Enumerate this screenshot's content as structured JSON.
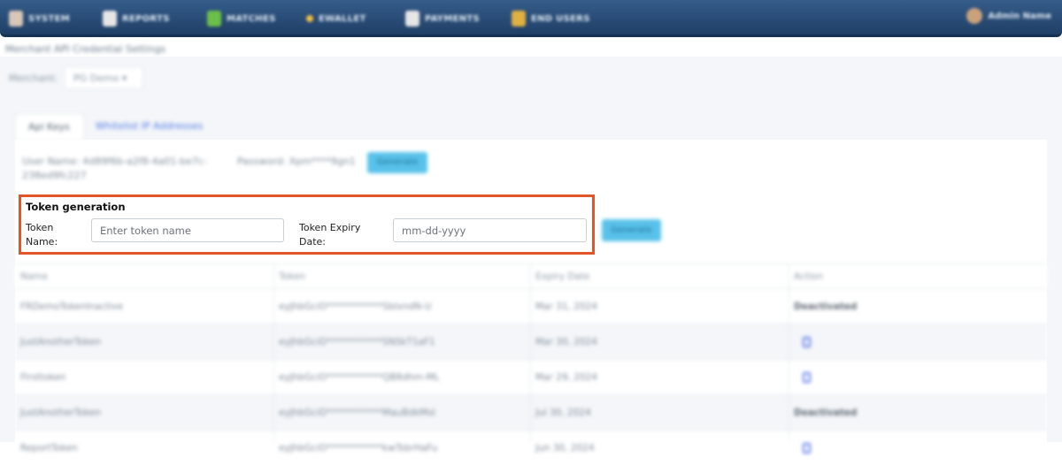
{
  "nav": {
    "items": [
      {
        "label": "SYSTEM",
        "icon": "system-icon",
        "color": "#d9c8b8"
      },
      {
        "label": "REPORTS",
        "icon": "reports-icon",
        "color": "#e6e6e6"
      },
      {
        "label": "MATCHES",
        "icon": "matches-icon",
        "color": "#6cc04a"
      },
      {
        "label": "EWALLET",
        "icon": "ewallet-icon",
        "color": "#f0c040"
      },
      {
        "label": "PAYMENTS",
        "icon": "payments-icon",
        "color": "#e6e6e6"
      },
      {
        "label": "END USERS",
        "icon": "end-users-icon",
        "color": "#e0b040"
      }
    ],
    "user": "Admin Name"
  },
  "breadcrumb": "Merchant API Credential Settings",
  "merchant": {
    "label": "Merchant:",
    "value": "PG Demo"
  },
  "tabs": {
    "api_keys": "Api Keys",
    "whitelist": "Whitelist IP Addresses"
  },
  "credentials": {
    "user_name": "User Name: 4d89f6b-a2f8-4a01-be7c-238ed9fc227",
    "password": "Password: Xpm****9gn1",
    "button": "Generate"
  },
  "token_generation": {
    "heading": "Token generation",
    "name_label_1": "Token",
    "name_label_2": "Name:",
    "name_placeholder": "Enter token name",
    "expiry_label_1": "Token Expiry",
    "expiry_label_2": "Date:",
    "expiry_placeholder": "mm-dd-yyyy",
    "button": "Generate"
  },
  "table": {
    "headers": [
      "Name",
      "Token",
      "Expiry Date",
      "Action"
    ],
    "rows": [
      {
        "name": "FRDemoTokenInactive",
        "token": "eyJhbGciO************SbIxndN-U",
        "expiry": "Mar 31, 2024",
        "action": "Deactivated"
      },
      {
        "name": "JustAnotherToken",
        "token": "eyJhbGciO************SNSkT1aF1",
        "expiry": "Mar 30, 2024",
        "action": ""
      },
      {
        "name": "Firsttoken",
        "token": "eyJhbGciO************QB8dhm-ML",
        "expiry": "Mar 29, 2024",
        "action": ""
      },
      {
        "name": "JustAnotherToken",
        "token": "eyJhbGciO************MauBdkMsI",
        "expiry": "Jul 30, 2024",
        "action": "Deactivated"
      },
      {
        "name": "ReportToken",
        "token": "eyJhbGciO************kwTsbrHaFu",
        "expiry": "Jun 30, 2024",
        "action": ""
      }
    ]
  }
}
